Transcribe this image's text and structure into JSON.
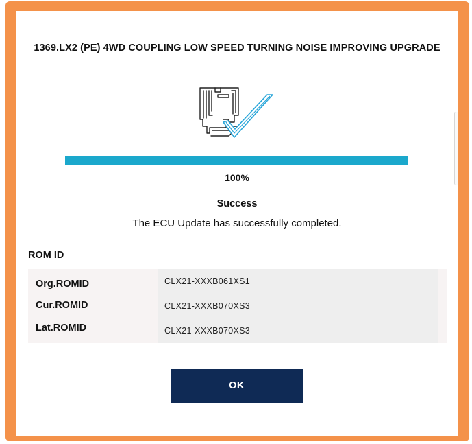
{
  "dialog": {
    "title": "1369.LX2 (PE) 4WD COUPLING LOW SPEED TURNING NOISE IMPROVING UPGRADE",
    "icon": "ecu-update-complete-icon",
    "progress": {
      "percent": 100,
      "label": "100%"
    },
    "status": "Success",
    "message": "The ECU Update has successfully completed.",
    "rom": {
      "title": "ROM ID",
      "rows": [
        {
          "label": "Org.ROMID",
          "value": "CLX21-XXXB061XS1"
        },
        {
          "label": "Cur.ROMID",
          "value": "CLX21-XXXB070XS3"
        },
        {
          "label": "Lat.ROMID",
          "value": "CLX21-XXXB070XS3"
        }
      ]
    },
    "ok_label": "OK"
  },
  "colors": {
    "frame": "#f4924a",
    "progress": "#1ba8cc",
    "button": "#0f2a55",
    "checkmark": "#2aa6d9"
  }
}
